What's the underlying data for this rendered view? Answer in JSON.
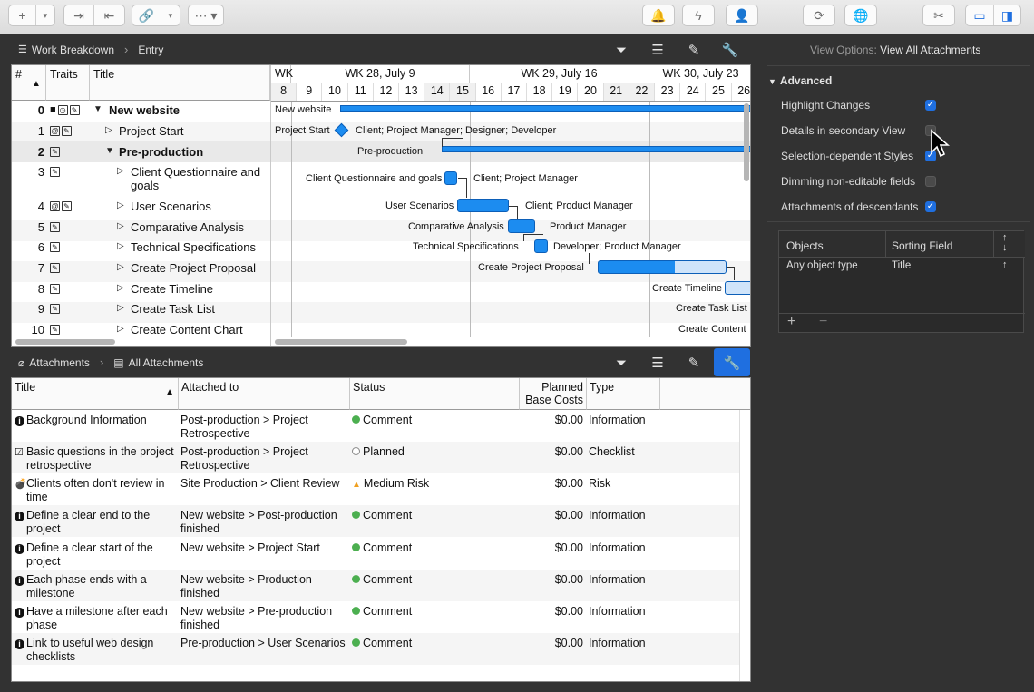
{
  "toolbar": {
    "add_icon": "plus-icon",
    "indent_icon": "indent-icon",
    "outdent_icon": "outdent-icon",
    "link_icon": "link-icon",
    "more_icon": "ellipsis-icon",
    "notify_icon": "bell-icon",
    "action_icon": "lightning-icon",
    "person_icon": "person-icon",
    "sync_icon": "sync-icon",
    "publish_icon": "globe-icon",
    "tools_icon": "tools-icon",
    "layout_icon": "layout-icon",
    "sidebar_icon": "sidebar-icon"
  },
  "outline": {
    "breadcrumb": {
      "view": "Work Breakdown",
      "entry": "Entry"
    },
    "headers": {
      "num": "#",
      "traits": "Traits",
      "title": "Title"
    },
    "rows": [
      {
        "num": "0",
        "title": "New website",
        "bold": true
      },
      {
        "num": "1",
        "title": "Project Start",
        "bold": false
      },
      {
        "num": "2",
        "title": "Pre-production",
        "bold": true
      },
      {
        "num": "3",
        "title": "Client Questionnaire and goals",
        "bold": false
      },
      {
        "num": "4",
        "title": "User Scenarios",
        "bold": false
      },
      {
        "num": "5",
        "title": "Comparative Analysis",
        "bold": false
      },
      {
        "num": "6",
        "title": "Technical Specifications",
        "bold": false
      },
      {
        "num": "7",
        "title": "Create Project Proposal",
        "bold": false
      },
      {
        "num": "8",
        "title": "Create Timeline",
        "bold": false
      },
      {
        "num": "9",
        "title": "Create Task List",
        "bold": false
      },
      {
        "num": "10",
        "title": "Create Content Chart",
        "bold": false
      }
    ]
  },
  "gantt": {
    "weeks": [
      "WK",
      "WK 28, July 9",
      "WK 29, July 16",
      "WK 30, July 23"
    ],
    "days": [
      "8",
      "9",
      "10",
      "11",
      "12",
      "13",
      "14",
      "15",
      "16",
      "17",
      "18",
      "19",
      "20",
      "21",
      "22",
      "23",
      "24",
      "25",
      "26"
    ],
    "labels": {
      "r0": "New website",
      "r1a": "Project Start",
      "r1b": "Client; Project Manager; Designer; Developer",
      "r2": "Pre-production",
      "r3a": "Client Questionnaire and goals",
      "r3b": "Client; Project Manager",
      "r4a": "User Scenarios",
      "r4b": "Client; Product Manager",
      "r5a": "Comparative Analysis",
      "r5b": "Product Manager",
      "r6a": "Technical Specifications",
      "r6b": "Developer; Product Manager",
      "r7a": "Create Project Proposal",
      "r8a": "Create Timeline",
      "r9a": "Create Task List",
      "r10a": "Create Content"
    }
  },
  "attachments": {
    "breadcrumb": {
      "view": "Attachments",
      "entry": "All Attachments"
    },
    "headers": {
      "title": "Title",
      "attached": "Attached to",
      "status": "Status",
      "planned": "Planned Base Costs",
      "type": "Type"
    },
    "rows": [
      {
        "title": "Background Information",
        "attached": "Post-production > Project Retrospective",
        "status": "Comment",
        "cost": "$0.00",
        "type": "Information"
      },
      {
        "title": "Basic questions in the project retrospective",
        "attached": "Post-production > Project Retrospective",
        "status": "Planned",
        "cost": "$0.00",
        "type": "Checklist"
      },
      {
        "title": "Clients often don't review in time",
        "attached": "Site Production > Client Review",
        "status": "Medium Risk",
        "cost": "$0.00",
        "type": "Risk"
      },
      {
        "title": "Define a clear end to the project",
        "attached": "New website > Post-production finished",
        "status": "Comment",
        "cost": "$0.00",
        "type": "Information"
      },
      {
        "title": "Define a clear start of the project",
        "attached": "New website > Project Start",
        "status": "Comment",
        "cost": "$0.00",
        "type": "Information"
      },
      {
        "title": "Each phase ends with a milestone",
        "attached": "New website > Production finished",
        "status": "Comment",
        "cost": "$0.00",
        "type": "Information"
      },
      {
        "title": "Have a milestone after each phase",
        "attached": "New website > Pre-production finished",
        "status": "Comment",
        "cost": "$0.00",
        "type": "Information"
      },
      {
        "title": "Link to useful web design checklists",
        "attached": "Pre-production > User Scenarios",
        "status": "Comment",
        "cost": "$0.00",
        "type": "Information"
      }
    ]
  },
  "options": {
    "title_prefix": "View Options:",
    "title_value": "View All Attachments",
    "section": "Advanced",
    "items": [
      {
        "label": "Highlight Changes",
        "checked": true
      },
      {
        "label": "Details in secondary View",
        "checked": false
      },
      {
        "label": "Selection-dependent Styles",
        "checked": true
      },
      {
        "label": "Dimming non-editable fields",
        "checked": false
      },
      {
        "label": "Attachments of descendants",
        "checked": true
      }
    ],
    "sort": {
      "col1": "Objects",
      "col2": "Sorting Field",
      "row_obj": "Any object type",
      "row_field": "Title",
      "add": "+",
      "remove": "−"
    }
  },
  "colors": {
    "accent": "#1f6fe0",
    "bar": "#1c8cf0",
    "comment": "#4caf50",
    "risk": "#f0a020"
  }
}
